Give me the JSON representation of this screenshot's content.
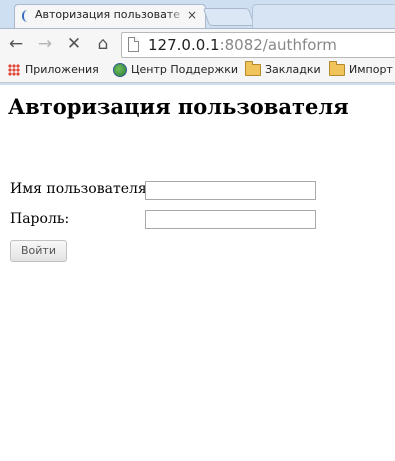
{
  "browser": {
    "active_tab_title": "Авторизация пользовате",
    "active_tab_close": "×",
    "url_host": "127.0.0.1",
    "url_rest": ":8082/authform",
    "bookmarks": {
      "apps": "Приложения",
      "support": "Центр Поддержки",
      "bookmarks": "Закладки",
      "import": "Импорт"
    }
  },
  "page": {
    "title": "Авторизация пользователя",
    "username_label": "Имя пользователя:",
    "username_value": "",
    "password_label": "Пароль:",
    "password_value": "",
    "submit_label": "Войти"
  }
}
